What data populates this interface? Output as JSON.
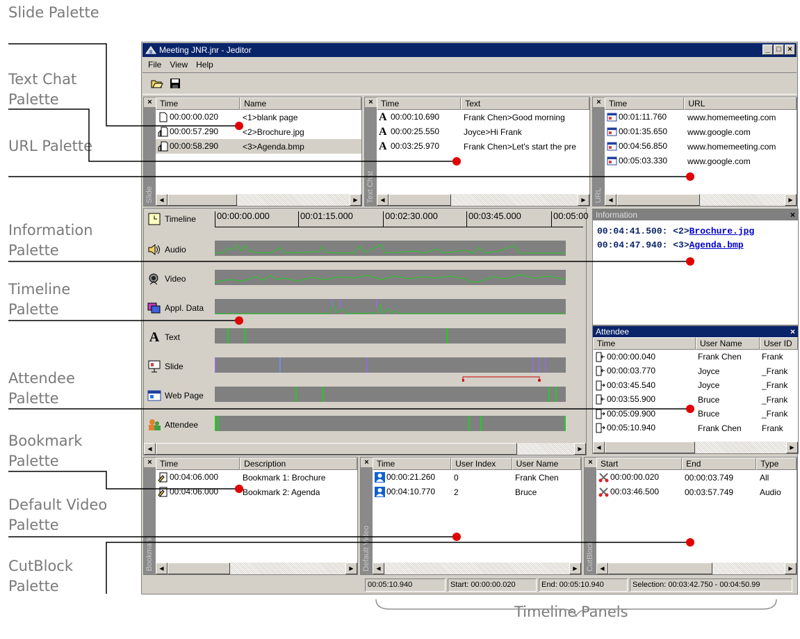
{
  "callouts": {
    "slide": "Slide Palette",
    "textchat": "Text Chat Palette",
    "url": "URL Palette",
    "information": "Information Palette",
    "timeline": "Timeline Palette",
    "attendee": "Attendee Palette",
    "bookmark": "Bookmark Palette",
    "defaultvideo": "Default Video Palette",
    "cutblock": "CutBlock Palette",
    "panels": "Timeline Panels"
  },
  "window": {
    "title": "Meeting JNR.jnr - Jeditor",
    "menu": [
      "File",
      "View",
      "Help"
    ],
    "toolbar": [
      "open-icon",
      "save-icon"
    ]
  },
  "slide": {
    "tab": "Slide",
    "headers": [
      "Time",
      "Name"
    ],
    "rows": [
      {
        "time": "00:00:00.020",
        "name": "<1>blank page"
      },
      {
        "time": "00:00:57.290",
        "name": "<2>Brochure.jpg"
      },
      {
        "time": "00:00:58.290",
        "name": "<3>Agenda.bmp"
      }
    ]
  },
  "textchat": {
    "tab": "Text Chat",
    "headers": [
      "Time",
      "Text"
    ],
    "rows": [
      {
        "time": "00:00:10.690",
        "text": "Frank Chen>Good morning"
      },
      {
        "time": "00:00:25.550",
        "text": "Joyce>Hi Frank"
      },
      {
        "time": "00:03:25.970",
        "text": "Frank Chen>Let's start the pre"
      }
    ]
  },
  "url": {
    "tab": "URL",
    "headers": [
      "Time",
      "URL"
    ],
    "rows": [
      {
        "time": "00:01:11.760",
        "url": "www.homemeeting.com"
      },
      {
        "time": "00:01:35.650",
        "url": "www.google.com"
      },
      {
        "time": "00:04:56.850",
        "url": "www.homemeeting.com"
      },
      {
        "time": "00:05:03.330",
        "url": "www.google.com"
      }
    ]
  },
  "timeline": {
    "ruler": [
      "00:00:00.000",
      "00:01:15.000",
      "00:02:30.000",
      "00:03:45.000",
      "00:05:00"
    ],
    "tracks": [
      "Timeline",
      "Audio",
      "Video",
      "Appl. Data",
      "Text",
      "Slide",
      "Web Page",
      "Attendee"
    ]
  },
  "information": {
    "title": "Information",
    "lines": [
      {
        "prefix": "00:04:41.500: <2>",
        "link": "Brochure.jpg"
      },
      {
        "prefix": "00:04:47.940: <3>",
        "link": "Agenda.bmp"
      }
    ]
  },
  "attendee": {
    "title": "Attendee",
    "headers": [
      "Time",
      "User Name",
      "User ID"
    ],
    "rows": [
      {
        "time": "00:00:00.040",
        "name": "Frank Chen",
        "id": "Frank"
      },
      {
        "time": "00:00:03.770",
        "name": "Joyce",
        "id": "_Frank"
      },
      {
        "time": "00:03:45.540",
        "name": "Joyce",
        "id": "_Frank"
      },
      {
        "time": "00:03:55.900",
        "name": "Bruce",
        "id": "_Frank"
      },
      {
        "time": "00:05:09.900",
        "name": "Bruce",
        "id": "_Frank"
      },
      {
        "time": "00:05:10.940",
        "name": "Frank Chen",
        "id": "Frank"
      }
    ]
  },
  "bookmark": {
    "tab": "Bookmark",
    "headers": [
      "Time",
      "Description"
    ],
    "rows": [
      {
        "time": "00:04:06.000",
        "desc": "Bookmark 1: Brochure"
      },
      {
        "time": "00:04:06.000",
        "desc": "Bookmark 2: Agenda"
      }
    ]
  },
  "defaultvideo": {
    "tab": "Default Video",
    "headers": [
      "Time",
      "User Index",
      "User Name"
    ],
    "rows": [
      {
        "time": "00:00:21.260",
        "index": "0",
        "name": "Frank Chen"
      },
      {
        "time": "00:04:10.770",
        "index": "2",
        "name": "Bruce"
      }
    ]
  },
  "cutblock": {
    "tab": "CutBlock",
    "headers": [
      "Start",
      "End",
      "Type"
    ],
    "rows": [
      {
        "start": "00:00:00.020",
        "end": "00:00:03.749",
        "type": "All"
      },
      {
        "start": "00:03:46.500",
        "end": "00:03:57.749",
        "type": "Audio"
      }
    ]
  },
  "status": {
    "current": "00:05:10.940",
    "start": "Start: 00:00:00.020",
    "end": "End: 00:05:10.940",
    "selection": "Selection: 00:03:42.750 - 00:04:50.99"
  },
  "colors": {
    "titlebar": "#0a246a",
    "chrome": "#d4d0c8",
    "accent": "#e00000",
    "signal": "#22cc22"
  }
}
